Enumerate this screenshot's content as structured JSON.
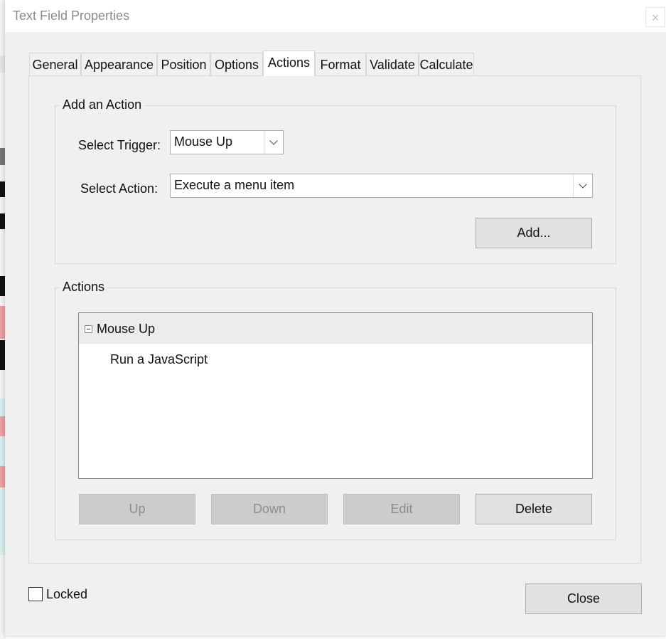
{
  "window": {
    "title": "Text Field Properties",
    "close_glyph": "×"
  },
  "tabs": [
    {
      "label": "General"
    },
    {
      "label": "Appearance"
    },
    {
      "label": "Position"
    },
    {
      "label": "Options"
    },
    {
      "label": "Actions",
      "active": true
    },
    {
      "label": "Format"
    },
    {
      "label": "Validate"
    },
    {
      "label": "Calculate"
    }
  ],
  "add_action": {
    "group_label": "Add an Action",
    "trigger_label": "Select Trigger:",
    "trigger_value": "Mouse Up",
    "action_label": "Select Action:",
    "action_value": "Execute a menu item",
    "add_button": "Add..."
  },
  "actions": {
    "group_label": "Actions",
    "tree": {
      "parent": "Mouse Up",
      "child": "Run a JavaScript"
    },
    "buttons": {
      "up": "Up",
      "down": "Down",
      "edit": "Edit",
      "delete": "Delete"
    }
  },
  "footer": {
    "locked_label": "Locked",
    "close_button": "Close"
  },
  "colors": {
    "dialog_bg": "#f0f0f0",
    "disabled_button_bg": "#cccccc",
    "button_bg": "#e1e1e1"
  }
}
